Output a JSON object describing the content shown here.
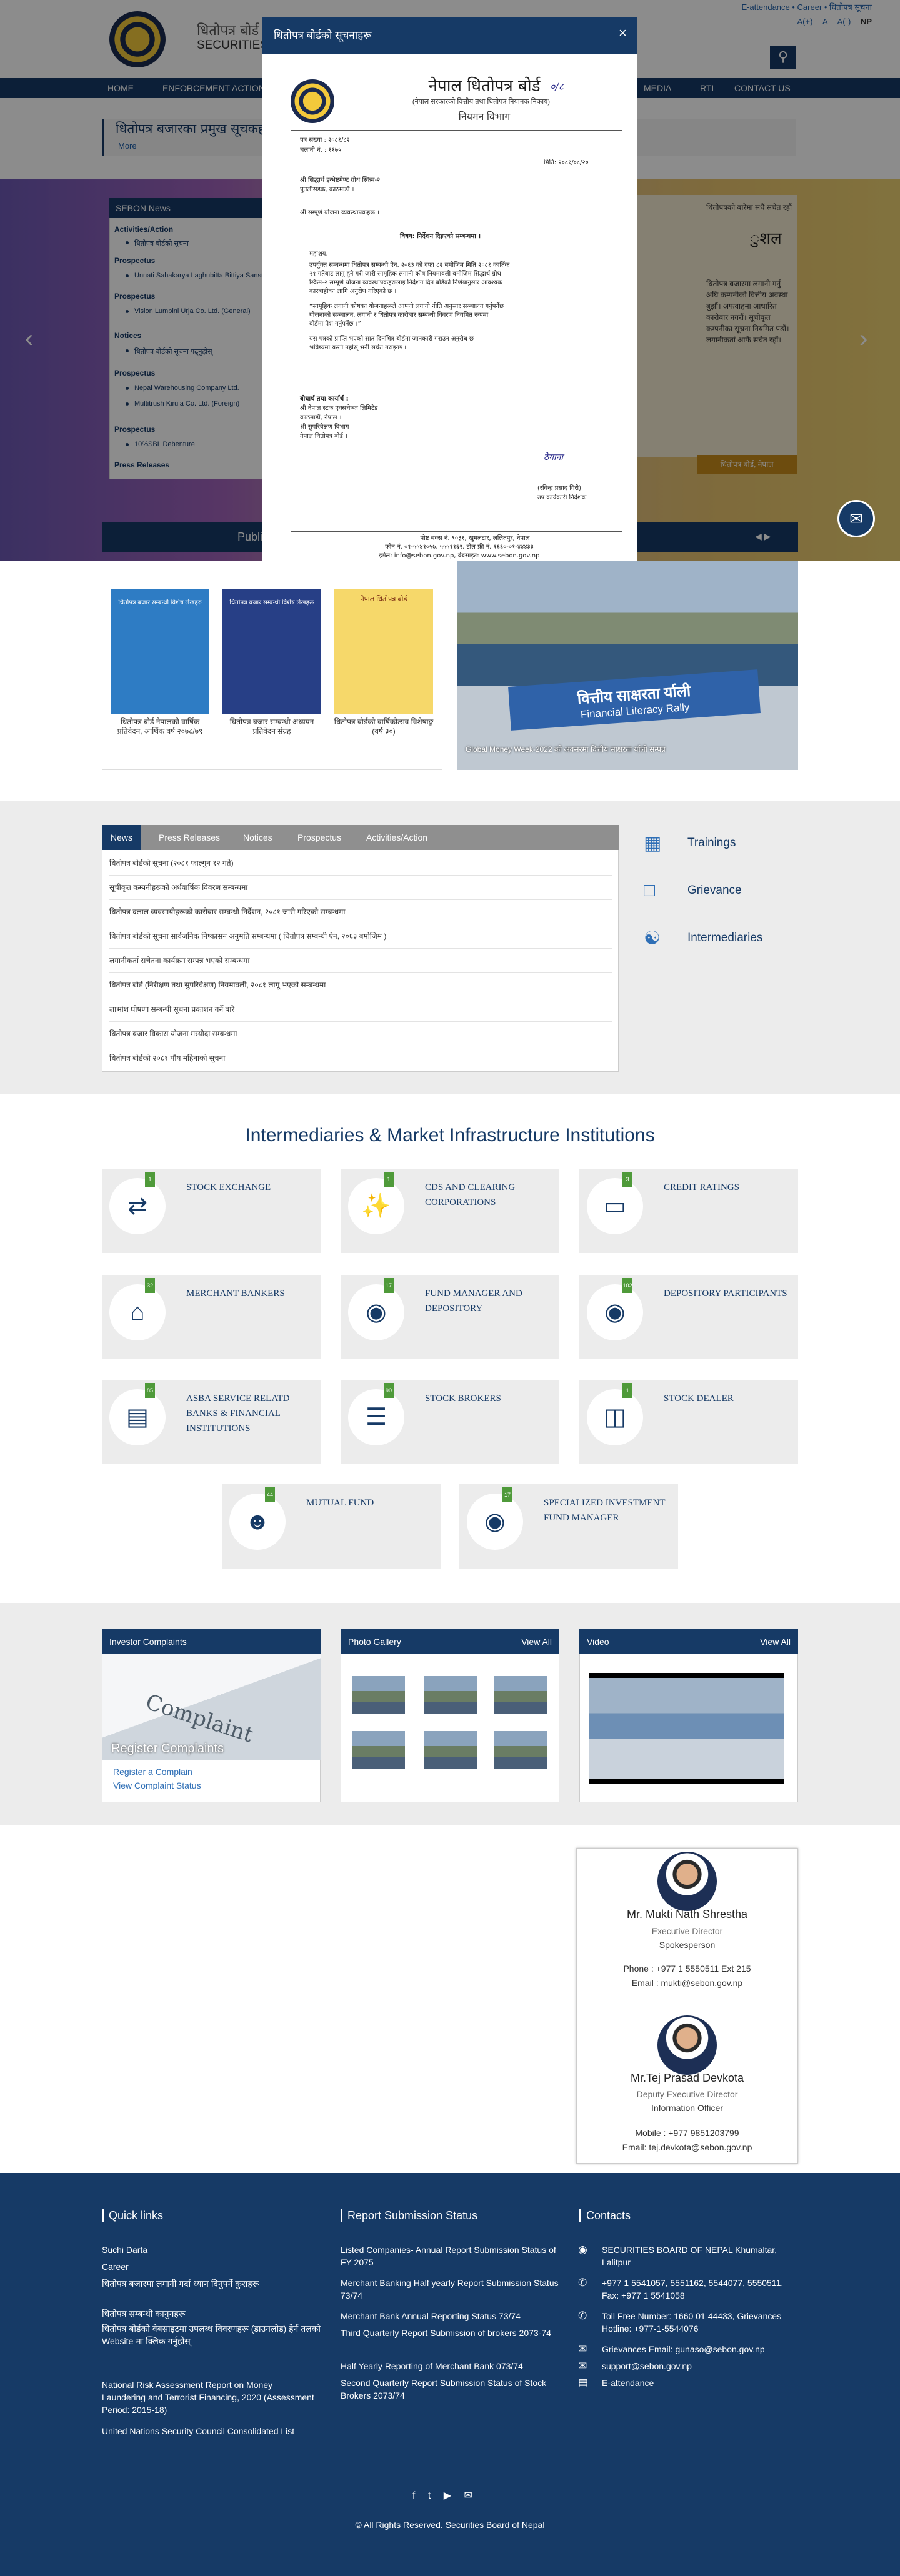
{
  "header": {
    "org_ne": "धितोपत्र बोर्ड",
    "org_en": "SECURITIES BOARD OF NEPAL",
    "top_links": "E-attendance • Career • धितोपत्र सूचना",
    "font_sizes": [
      "A(+)",
      "A",
      "A(-)"
    ],
    "lang": "NP",
    "search_icon": "search-icon"
  },
  "nav": [
    "HOME",
    "ENFORCEMENT ACTION",
    "MEDIA",
    "RTI",
    "CONTACT US"
  ],
  "crumb": {
    "title": "धितोपत्र बजारका प्रमुख सूचकहरू",
    "more": "More"
  },
  "slider": {
    "doc_title": "ुशल",
    "doc_sub": "धितोपत्रको बारेमा सधैं सचेत रहौं",
    "doc_text": "धितोपत्र बजारमा लगानी गर्नु अघि कम्पनीको वित्तीय अवस्था बुझौं। अफवाहमा आधारित कारोबार नगरौं। सूचीकृत कम्पनीका सूचना नियमित पढौं। लगानीकर्ता आफैं सचेत रहौं।",
    "doc_bar": "धितोपत्र बोर्ड, नेपाल",
    "prev": "‹",
    "next": "›"
  },
  "sebon_news": {
    "title": "SEBON News",
    "groups": [
      {
        "label": "Activities/Action",
        "items": [
          "धितोपत्र बोर्डको सूचना"
        ]
      },
      {
        "label": "Prospectus",
        "items": [
          "Unnati Sahakarya Laghubitta Bittiya Sanstha"
        ]
      },
      {
        "label": "Prospectus",
        "items": [
          "Vision Lumbini Urja Co. Ltd. (General)"
        ]
      },
      {
        "label": "Notices",
        "items": [
          "धितोपत्र बोर्डको सूचना पढ्नुहोस्"
        ]
      },
      {
        "label": "Prospectus",
        "items": [
          "Nepal Warehousing Company Ltd.",
          "Multitrush Kirula Co. Ltd. (Foreign)"
        ]
      },
      {
        "label": "Prospectus",
        "items": [
          "10%SBL Debenture"
        ]
      }
    ],
    "press": "Press Releases"
  },
  "publications": {
    "title": "Publications",
    "books": [
      {
        "caption": "धितोपत्र बोर्ड नेपालको वार्षिक प्रतिवेदन, आर्थिक वर्ष २०७८/७९",
        "cover_title": "धितोपत्र बजार सम्बन्धी विशेष लेखहरु"
      },
      {
        "caption": "धितोपत्र बजार सम्बन्धी अध्ययन प्रतिवेदन संग्रह",
        "cover_title": "धितोपत्र बजार सम्बन्धी विशेष लेखहरू"
      },
      {
        "caption": "धितोपत्र बोर्डको वार्षिकोत्सव विशेषाङ्क (वर्ष ३०)",
        "cover_title": "नेपाल धितोपत्र बोर्ड"
      }
    ],
    "event_banner_ne": "वित्तीय साक्षरता र्याली",
    "event_banner_en": "Financial Literacy Rally",
    "event_caption": "Global Money Week-2022 को अवसरमा वित्तीय साक्षरता र्याली सम्पन्न"
  },
  "news_tabs": {
    "tabs": [
      "News",
      "Press Releases",
      "Notices",
      "Prospectus",
      "Activities/Action"
    ],
    "rows": [
      "धितोपत्र बोर्डको सूचना (२०८१ फाल्गुन १२ गते)",
      "सूचीकृत कम्पनीहरूको अर्धवार्षिक विवरण सम्बन्धमा",
      "धितोपत्र दलाल व्यवसायीहरूको कारोबार सम्बन्धी निर्देशन, २०८१ जारी गरिएको सम्बन्धमा",
      "धितोपत्र बोर्डको सूचना सार्वजनिक निष्कासन अनुमति सम्बन्धमा ( धितोपत्र सम्बन्धी ऐन, २०६३ बमोजिम )",
      "लगानीकर्ता सचेतना कार्यक्रम सम्पन्न भएको सम्बन्धमा",
      "धितोपत्र बोर्ड (निरीक्षण तथा सुपरिवेक्षण) नियमावली, २०८१ लागू भएको सम्बन्धमा",
      "लाभांश घोषणा सम्बन्धी सूचना प्रकाशन गर्ने बारे",
      "धितोपत्र बजार विकास योजना मस्यौदा सम्बन्धमा",
      "धितोपत्र बोर्डको २०८१ पौष महिनाको सूचना"
    ]
  },
  "side_links": [
    {
      "label": "Trainings",
      "icon": "presentation-icon"
    },
    {
      "label": "Grievance",
      "icon": "chat-icon"
    },
    {
      "label": "Intermediaries",
      "icon": "handshake-icon"
    }
  ],
  "intermediaries": {
    "title": "Intermediaries & Market Infrastructure Institutions",
    "cards": [
      {
        "label": "STOCK EXCHANGE",
        "count": "1",
        "icon": "exchange-icon"
      },
      {
        "label": "CDS AND CLEARING CORPORATIONS",
        "count": "1",
        "icon": "broom-icon"
      },
      {
        "label": "CREDIT RATINGS",
        "count": "3",
        "icon": "credit-card-icon"
      },
      {
        "label": "MERCHANT BANKERS",
        "count": "32",
        "icon": "bank-icon"
      },
      {
        "label": "FUND MANAGER AND DEPOSITORY",
        "count": "17",
        "icon": "piggy-bank-icon"
      },
      {
        "label": "DEPOSITORY PARTICIPANTS",
        "count": "102",
        "icon": "fill-drip-icon"
      },
      {
        "label": "ASBA SERVICE RELATD BANKS & FINANCIAL INSTITUTIONS",
        "count": "85",
        "icon": "card-icon"
      },
      {
        "label": "STOCK BROKERS",
        "count": "90",
        "icon": "list-icon"
      },
      {
        "label": "STOCK DEALER",
        "count": "1",
        "icon": "layers-icon"
      },
      {
        "label": "MUTUAL FUND",
        "count": "44",
        "icon": "users-icon"
      },
      {
        "label": "SPECIALIZED INVESTMENT FUND MANAGER",
        "count": "17",
        "icon": "piggy-bank-icon"
      }
    ]
  },
  "widgets": {
    "complaints": {
      "title": "Investor Complaints",
      "img_word": "Complaint",
      "register": "Register Complaints",
      "link1": "Register a Complain",
      "link2": "View Complaint Status"
    },
    "gallery": {
      "title": "Photo Gallery",
      "view_all": "View All"
    },
    "video": {
      "title": "Video",
      "view_all": "View All"
    }
  },
  "spokesperson": [
    {
      "name": "Mr. Mukti Nath Shrestha",
      "title": "Executive Director",
      "role": "Spokesperson",
      "phone": "Phone : +977 1 5550511 Ext 215",
      "email": "Email : mukti@sebon.gov.np"
    },
    {
      "name": "Mr.Tej Prasad Devkota",
      "title": "Deputy Executive Director",
      "role": "Information Officer",
      "phone": "Mobile : +977 9851203799",
      "email": "Email: tej.devkota@sebon.gov.np"
    }
  ],
  "footer": {
    "quick_links_title": "Quick links",
    "quick_links": [
      "Suchi Darta",
      "Career",
      "धितोपत्र बजारमा लगानी गर्दा ध्यान दिनुपर्ने कुराहरू",
      "धितोपत्र सम्बन्धी कानुनहरू",
      "धितोपत्र बोर्डको वेबसाइटमा उपलब्ध विवरणहरू (डाउनलोड) हेर्न तलको Website मा क्लिक गर्नुहोस्",
      "National Risk Assessment Report on Money Laundering and Terrorist Financing, 2020 (Assessment Period: 2015-18)",
      "United Nations Security Council Consolidated List"
    ],
    "report_title": "Report Submission Status",
    "reports": [
      "Listed Companies- Annual Report Submission Status of FY 2075",
      "Merchant Banking Half yearly Report Submission Status 73/74",
      "Merchant Bank Annual Reporting Status 73/74",
      "Third Quarterly Report Submission of brokers 2073-74",
      "Half Yearly Reporting of Merchant Bank 073/74",
      "Second Quarterly Report Submission Status of Stock Brokers 2073/74"
    ],
    "contacts_title": "Contacts",
    "contacts": [
      {
        "icon": "location-icon",
        "text": "SECURITIES BOARD OF NEPAL Khumaltar, Lalitpur"
      },
      {
        "icon": "phone-icon",
        "text": "+977 1 5541057, 5551162, 5544077, 5550511, Fax: +977 1 5541058"
      },
      {
        "icon": "phone-icon",
        "text": "Toll Free Number: 1660 01 44433, Grievances Hotline: +977-1-5544076"
      },
      {
        "icon": "mail-icon",
        "text": "Grievances Email: gunaso@sebon.gov.np"
      },
      {
        "icon": "mail-icon",
        "text": "support@sebon.gov.np"
      },
      {
        "icon": "file-icon",
        "text": "E-attendance"
      }
    ],
    "social": "f t ▶ ✉",
    "copyright": "© All Rights Reserved.   Securities Board of Nepal"
  },
  "modal": {
    "title": "धितोपत्र बोर्डको सूचनाहरू",
    "close": "×",
    "letter": {
      "org": "नेपाल धितोपत्र बोर्ड",
      "org_sub": "(नेपाल सरकारको वित्तीय तथा धितोपत्र नियामक निकाय)",
      "dept": "नियमन विभाग",
      "ref": "पत्र संख्या : २०८१/८२",
      "chalani": "चलानी नं. :  ११७५",
      "date": "मिति: २०८१/०८/२०",
      "to1": "श्री सिद्धार्थ इन्भेष्टमेण्ट ग्रोथ स्किम-२",
      "to2": "पुतलीसडक, काठमाडौं ।",
      "to3": "श्री सम्पूर्ण योजना व्यवस्थापकहरू ।",
      "subject": "विषय: निर्देशन दिइएको सम्बन्धमा ।",
      "greet": "महाशय,",
      "body": [
        "उपर्युक्त सम्बन्धमा धितोपत्र सम्बन्धी ऐन, २०६३ को दफा ८२ बमोजिम मिति २०८१ कार्तिक",
        "२१ गतेबाट लागु हुने गरी जारी सामूहिक लगानी कोष नियमावली बमोजिम सिद्धार्थ ग्रोथ",
        "स्किम-२ सम्पूर्ण योजना व्यवस्थापकहरूलाई निर्देशन दिन बोर्डको निर्णयानुसार आवश्यक",
        "कारबाहीका लागि अनुरोध गरिएको छ ।",
        "“सामूहिक लगानी कोषका योजनाहरूले आफ्नो लगानी नीति अनुसार सञ्चालन गर्नुपर्नेछ ।",
        "योजनाको सञ्चालन, लगानी र धितोपत्र कारोबार सम्बन्धी विवरण नियमित रूपमा",
        "बोर्डमा पेश गर्नुपर्नेछ ।”",
        "यस पत्रको प्राप्ति भएको सात दिनभित्र बोर्डमा जानकारी गराउन अनुरोध छ ।",
        "भविष्यमा यस्तो नहोस् भनी सचेत गराइन्छ ।"
      ],
      "cc_title": "बोधार्थ तथा कार्यार्थ :",
      "cc": [
        "श्री नेपाल स्टक एक्सचेञ्ज लिमिटेड",
        "काठमाडौं, नेपाल ।",
        "श्री सुपरिवेक्षण विभाग",
        "नेपाल धितोपत्र बोर्ड ।"
      ],
      "sign_name": "(रविन्द्र प्रसाद गिरी)",
      "sign_title": "उप कार्यकारी निर्देशक",
      "sig": "ठेगाना",
      "footer1": "पोष्ट बक्स नं. ९०३१, खुमलटार, ललितपुर, नेपाल",
      "footer2": "फोन नं. ०१-५५४१०५७, ५५५११६२, टोल फ्री नं. १६६०-०१-४४४३३",
      "footer3": "इमेल: info@sebon.gov.np,  वेबसाइट: www.sebon.gov.np"
    }
  },
  "chat_icon": "chat-bubble-icon"
}
